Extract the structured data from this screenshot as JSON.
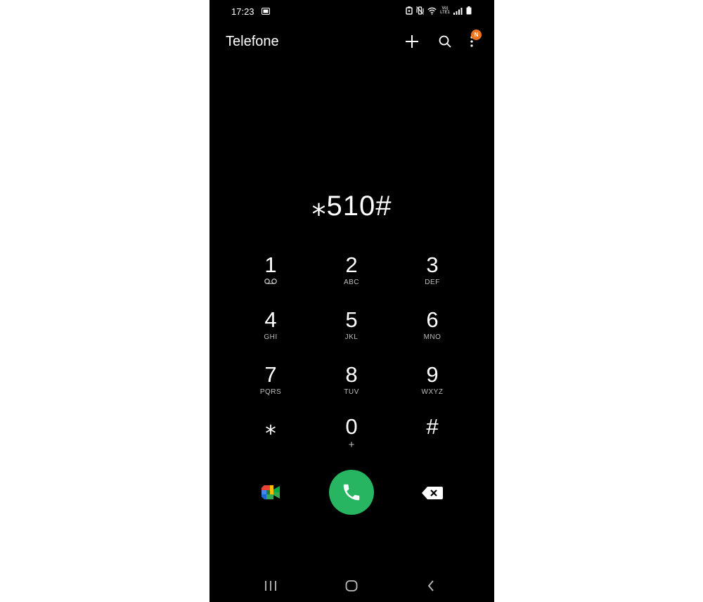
{
  "status_bar": {
    "time": "17:23",
    "network_label_top": "Vo)",
    "network_label_bottom": "LTE1"
  },
  "app_bar": {
    "title": "Telefone",
    "badge": "N",
    "icons": [
      "plus-icon",
      "search-icon",
      "more-vert-icon"
    ]
  },
  "dialer": {
    "number": "⁎510#"
  },
  "keypad": {
    "keys": [
      {
        "digit": "1",
        "sub": "voicemail-icon"
      },
      {
        "digit": "2",
        "sub": "ABC"
      },
      {
        "digit": "3",
        "sub": "DEF"
      },
      {
        "digit": "4",
        "sub": "GHI"
      },
      {
        "digit": "5",
        "sub": "JKL"
      },
      {
        "digit": "6",
        "sub": "MNO"
      },
      {
        "digit": "7",
        "sub": "PQRS"
      },
      {
        "digit": "8",
        "sub": "TUV"
      },
      {
        "digit": "9",
        "sub": "WXYZ"
      },
      {
        "digit": "⁎",
        "sub": ""
      },
      {
        "digit": "0",
        "sub": "+"
      },
      {
        "digit": "#",
        "sub": ""
      }
    ]
  },
  "actions": {
    "icons": [
      "google-meet-icon",
      "phone-icon",
      "backspace-icon"
    ],
    "call_color": "#27b561"
  },
  "nav_bar": {
    "icons": [
      "recents-icon",
      "home-icon",
      "back-icon"
    ]
  },
  "colors": {
    "background": "#000000",
    "accent_green": "#27b561",
    "badge_orange": "#f0741f"
  }
}
